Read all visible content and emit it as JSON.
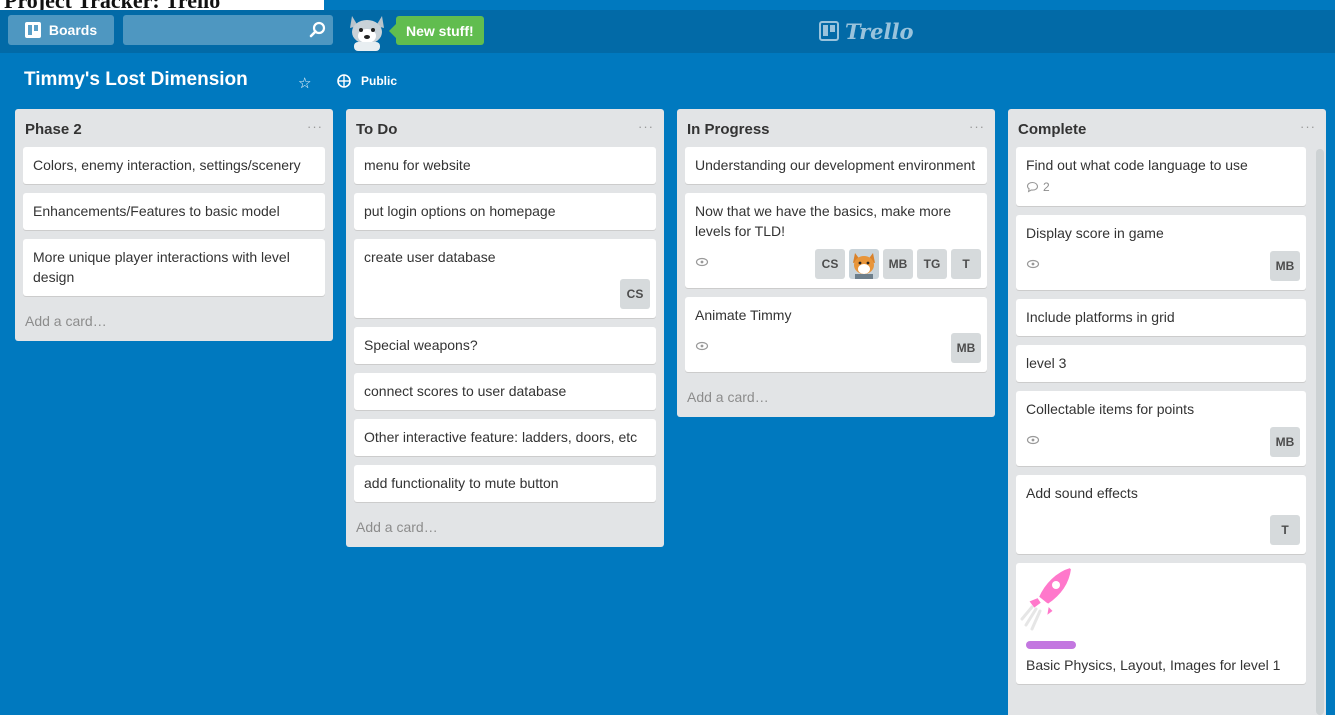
{
  "page_heading": "Project Tracker: Trello",
  "topbar": {
    "boards_label": "Boards",
    "search_value": "",
    "new_stuff_label": "New stuff!",
    "logo_text": "Trello"
  },
  "board": {
    "title": "Timmy's Lost Dimension",
    "visibility": "Public"
  },
  "add_card_label": "Add a card…",
  "lists": [
    {
      "title": "Phase 2",
      "cards": [
        {
          "title": "Colors, enemy interaction, settings/scenery"
        },
        {
          "title": "Enhancements/Features to basic model"
        },
        {
          "title": "More unique player interactions with level design"
        }
      ]
    },
    {
      "title": "To Do",
      "cards": [
        {
          "title": "menu for website"
        },
        {
          "title": "put login options on homepage"
        },
        {
          "title": "create user database",
          "members": [
            "CS"
          ]
        },
        {
          "title": "Special weapons?"
        },
        {
          "title": "connect scores to user database"
        },
        {
          "title": "Other interactive feature: ladders, doors, etc"
        },
        {
          "title": "add functionality to mute button"
        }
      ]
    },
    {
      "title": "In Progress",
      "cards": [
        {
          "title": "Understanding our development environment"
        },
        {
          "title": "Now that we have the basics, make more levels for TLD!",
          "members": [
            "CS",
            "MB",
            "TG",
            "T"
          ]
        },
        {
          "title": "Animate Timmy",
          "members": [
            "MB"
          ]
        }
      ]
    },
    {
      "title": "Complete",
      "cards": [
        {
          "title": "Find out what code language to use",
          "comments": "2"
        },
        {
          "title": "Display score in game",
          "members": [
            "MB"
          ]
        },
        {
          "title": "Include platforms in grid"
        },
        {
          "title": "level 3"
        },
        {
          "title": "Collectable items for points",
          "members": [
            "MB"
          ]
        },
        {
          "title": "Add sound effects",
          "members": [
            "T"
          ]
        },
        {
          "title": "Basic Physics, Layout, Images for level 1",
          "label_color": "#c377e0"
        }
      ]
    }
  ],
  "list_menu_glyph": "···",
  "colors": {
    "board_bg": "#0079bf",
    "header_bg": "#026aa7",
    "list_bg": "#e2e4e6",
    "new_stuff_green": "#61bd4f",
    "label_purple": "#c377e0",
    "rocket_pink": "#ff78cb"
  }
}
